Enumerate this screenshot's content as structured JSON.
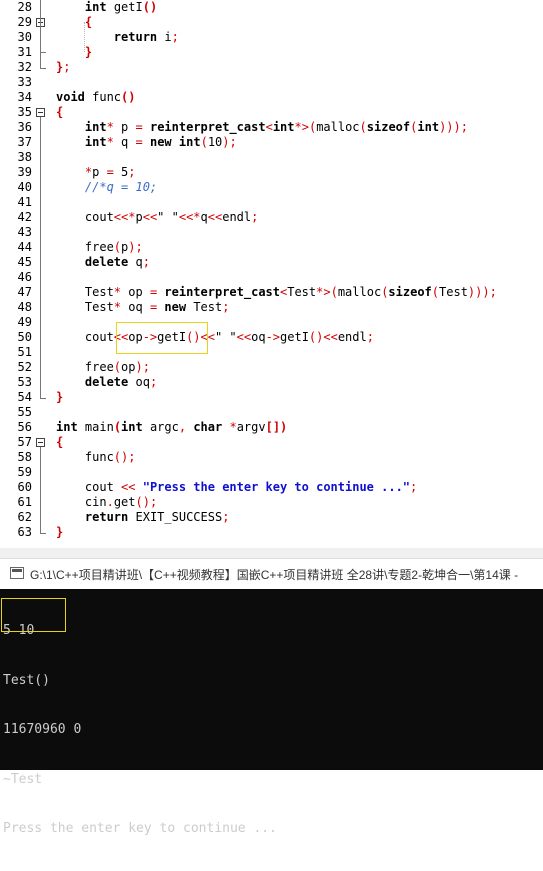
{
  "editor": {
    "lines": [
      {
        "n": "28",
        "segs": [
          {
            "t": "    "
          },
          {
            "t": "int",
            "c": "kw"
          },
          {
            "t": " getI"
          },
          {
            "t": "()",
            "c": "red kw"
          }
        ]
      },
      {
        "n": "29",
        "segs": [
          {
            "t": "    "
          },
          {
            "t": "{",
            "c": "red kw"
          }
        ]
      },
      {
        "n": "30",
        "segs": [
          {
            "t": "        "
          },
          {
            "t": "return",
            "c": "kw"
          },
          {
            "t": " i"
          },
          {
            "t": ";",
            "c": "red"
          }
        ]
      },
      {
        "n": "31",
        "segs": [
          {
            "t": "    "
          },
          {
            "t": "}",
            "c": "red kw"
          }
        ]
      },
      {
        "n": "32",
        "segs": [
          {
            "t": "}",
            "c": "red kw"
          },
          {
            "t": ";",
            "c": "red"
          }
        ]
      },
      {
        "n": "33",
        "segs": []
      },
      {
        "n": "34",
        "segs": [
          {
            "t": "void",
            "c": "kw"
          },
          {
            "t": " func"
          },
          {
            "t": "()",
            "c": "red kw"
          }
        ]
      },
      {
        "n": "35",
        "segs": [
          {
            "t": "{",
            "c": "red kw"
          }
        ]
      },
      {
        "n": "36",
        "segs": [
          {
            "t": "    "
          },
          {
            "t": "int",
            "c": "kw"
          },
          {
            "t": "*",
            "c": "red"
          },
          {
            "t": " p "
          },
          {
            "t": "=",
            "c": "red"
          },
          {
            "t": " "
          },
          {
            "t": "reinterpret_cast",
            "c": "kw"
          },
          {
            "t": "<",
            "c": "red"
          },
          {
            "t": "int",
            "c": "kw"
          },
          {
            "t": "*>(",
            "c": "red"
          },
          {
            "t": "malloc"
          },
          {
            "t": "(",
            "c": "red"
          },
          {
            "t": "sizeof",
            "c": "kw"
          },
          {
            "t": "(",
            "c": "red"
          },
          {
            "t": "int",
            "c": "kw"
          },
          {
            "t": ")));",
            "c": "red"
          }
        ]
      },
      {
        "n": "37",
        "segs": [
          {
            "t": "    "
          },
          {
            "t": "int",
            "c": "kw"
          },
          {
            "t": "*",
            "c": "red"
          },
          {
            "t": " q "
          },
          {
            "t": "=",
            "c": "red"
          },
          {
            "t": " "
          },
          {
            "t": "new",
            "c": "kw"
          },
          {
            "t": " "
          },
          {
            "t": "int",
            "c": "kw"
          },
          {
            "t": "(",
            "c": "red"
          },
          {
            "t": "10"
          },
          {
            "t": ");",
            "c": "red"
          }
        ]
      },
      {
        "n": "38",
        "segs": []
      },
      {
        "n": "39",
        "segs": [
          {
            "t": "    "
          },
          {
            "t": "*",
            "c": "red"
          },
          {
            "t": "p "
          },
          {
            "t": "=",
            "c": "red"
          },
          {
            "t": " 5"
          },
          {
            "t": ";",
            "c": "red"
          }
        ]
      },
      {
        "n": "40",
        "segs": [
          {
            "t": "    "
          },
          {
            "t": "//*q = 10;",
            "c": "cmt"
          }
        ]
      },
      {
        "n": "41",
        "segs": []
      },
      {
        "n": "42",
        "segs": [
          {
            "t": "    cout"
          },
          {
            "t": "<<*",
            "c": "red"
          },
          {
            "t": "p"
          },
          {
            "t": "<<",
            "c": "red"
          },
          {
            "t": "\" \""
          },
          {
            "t": "<<*",
            "c": "red"
          },
          {
            "t": "q"
          },
          {
            "t": "<<",
            "c": "red"
          },
          {
            "t": "endl"
          },
          {
            "t": ";",
            "c": "red"
          }
        ]
      },
      {
        "n": "43",
        "segs": []
      },
      {
        "n": "44",
        "segs": [
          {
            "t": "    free"
          },
          {
            "t": "(",
            "c": "red"
          },
          {
            "t": "p"
          },
          {
            "t": ");",
            "c": "red"
          }
        ]
      },
      {
        "n": "45",
        "segs": [
          {
            "t": "    "
          },
          {
            "t": "delete",
            "c": "kw"
          },
          {
            "t": " q"
          },
          {
            "t": ";",
            "c": "red"
          }
        ]
      },
      {
        "n": "46",
        "segs": []
      },
      {
        "n": "47",
        "segs": [
          {
            "t": "    Test"
          },
          {
            "t": "*",
            "c": "red"
          },
          {
            "t": " op "
          },
          {
            "t": "=",
            "c": "red"
          },
          {
            "t": " "
          },
          {
            "t": "reinterpret_cast",
            "c": "kw"
          },
          {
            "t": "<",
            "c": "red"
          },
          {
            "t": "Test"
          },
          {
            "t": "*>(",
            "c": "red"
          },
          {
            "t": "malloc"
          },
          {
            "t": "(",
            "c": "red"
          },
          {
            "t": "sizeof",
            "c": "kw"
          },
          {
            "t": "(",
            "c": "red"
          },
          {
            "t": "Test"
          },
          {
            "t": ")));",
            "c": "red"
          }
        ]
      },
      {
        "n": "48",
        "segs": [
          {
            "t": "    Test"
          },
          {
            "t": "*",
            "c": "red"
          },
          {
            "t": " oq "
          },
          {
            "t": "=",
            "c": "red"
          },
          {
            "t": " "
          },
          {
            "t": "new",
            "c": "kw"
          },
          {
            "t": " Test"
          },
          {
            "t": ";",
            "c": "red"
          }
        ]
      },
      {
        "n": "49",
        "segs": []
      },
      {
        "n": "50",
        "segs": [
          {
            "t": "    cout"
          },
          {
            "t": "<<",
            "c": "red"
          },
          {
            "t": "op"
          },
          {
            "t": "->",
            "c": "red"
          },
          {
            "t": "getI"
          },
          {
            "t": "()<<",
            "c": "red"
          },
          {
            "t": "\" \""
          },
          {
            "t": "<<",
            "c": "red"
          },
          {
            "t": "oq"
          },
          {
            "t": "->",
            "c": "red"
          },
          {
            "t": "getI"
          },
          {
            "t": "()<<",
            "c": "red"
          },
          {
            "t": "endl"
          },
          {
            "t": ";",
            "c": "red"
          }
        ]
      },
      {
        "n": "51",
        "segs": []
      },
      {
        "n": "52",
        "segs": [
          {
            "t": "    free"
          },
          {
            "t": "(",
            "c": "red"
          },
          {
            "t": "op"
          },
          {
            "t": ");",
            "c": "red"
          }
        ]
      },
      {
        "n": "53",
        "segs": [
          {
            "t": "    "
          },
          {
            "t": "delete",
            "c": "kw"
          },
          {
            "t": " oq"
          },
          {
            "t": ";",
            "c": "red"
          }
        ]
      },
      {
        "n": "54",
        "segs": [
          {
            "t": "}",
            "c": "red kw"
          }
        ]
      },
      {
        "n": "55",
        "segs": []
      },
      {
        "n": "56",
        "segs": [
          {
            "t": "int",
            "c": "kw"
          },
          {
            "t": " main"
          },
          {
            "t": "(",
            "c": "red kw"
          },
          {
            "t": "int",
            "c": "kw"
          },
          {
            "t": " argc"
          },
          {
            "t": ",",
            "c": "red"
          },
          {
            "t": " "
          },
          {
            "t": "char",
            "c": "kw"
          },
          {
            "t": " "
          },
          {
            "t": "*",
            "c": "red"
          },
          {
            "t": "argv"
          },
          {
            "t": "[])",
            "c": "red kw"
          }
        ]
      },
      {
        "n": "57",
        "segs": [
          {
            "t": "{",
            "c": "red kw"
          }
        ]
      },
      {
        "n": "58",
        "segs": [
          {
            "t": "    func"
          },
          {
            "t": "();",
            "c": "red"
          }
        ]
      },
      {
        "n": "59",
        "segs": []
      },
      {
        "n": "60",
        "segs": [
          {
            "t": "    cout "
          },
          {
            "t": "<<",
            "c": "red"
          },
          {
            "t": " "
          },
          {
            "t": "\"Press the enter key to continue ...\"",
            "c": "blue"
          },
          {
            "t": ";",
            "c": "red"
          }
        ]
      },
      {
        "n": "61",
        "segs": [
          {
            "t": "    cin"
          },
          {
            "t": ".",
            "c": "red"
          },
          {
            "t": "get"
          },
          {
            "t": "();",
            "c": "red"
          }
        ]
      },
      {
        "n": "62",
        "segs": [
          {
            "t": "    "
          },
          {
            "t": "return",
            "c": "kw"
          },
          {
            "t": " EXIT_SUCCESS"
          },
          {
            "t": ";",
            "c": "red"
          }
        ]
      },
      {
        "n": "63",
        "segs": [
          {
            "t": "}",
            "c": "red kw"
          }
        ]
      }
    ]
  },
  "console": {
    "title": "G:\\1\\C++项目精讲班\\【C++视频教程】国嵌C++项目精讲班 全28讲\\专题2-乾坤合一\\第14课 -",
    "lines": [
      "5 10",
      "Test()",
      "11670960 0",
      "~Test",
      "Press the enter key to continue ..."
    ]
  },
  "colors": {
    "keyword": "#000000",
    "operator": "#d00000",
    "string": "#1010d0",
    "comment": "#3a6ec8",
    "highlight_box": "#e6d31a",
    "console_bg": "#0c0c0c",
    "console_fg": "#cccccc"
  }
}
